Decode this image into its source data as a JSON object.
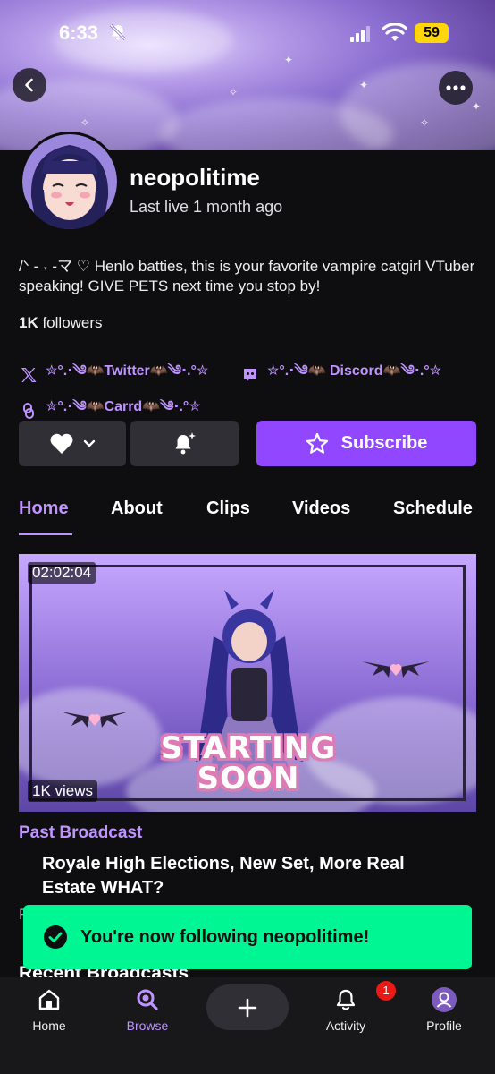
{
  "status_bar": {
    "time": "6:33",
    "battery": "59"
  },
  "channel": {
    "name": "neopolitime",
    "last_live": "Last live 1 month ago",
    "bio": "/ᐠ - ˕ -マ ♡ Henlo batties, this is your favorite vampire catgirl VTuber speaking! GIVE PETS next time you stop by!",
    "followers_count": "1K",
    "followers_label": " followers"
  },
  "socials": [
    {
      "icon": "x-icon",
      "label": "✮°.⋅༄🦇Twitter🦇༄⋅.°✮"
    },
    {
      "icon": "discord-icon",
      "label": "✮°.⋅༄🦇 Discord🦇༄⋅.°✮"
    },
    {
      "icon": "link-icon",
      "label": "✮°.⋅༄🦇Carrd🦇༄⋅.°✮"
    }
  ],
  "actions": {
    "subscribe_label": "Subscribe"
  },
  "tabs": [
    {
      "label": "Home",
      "active": true
    },
    {
      "label": "About"
    },
    {
      "label": "Clips"
    },
    {
      "label": "Videos"
    },
    {
      "label": "Schedule"
    }
  ],
  "video": {
    "duration": "02:02:04",
    "views": "1K views",
    "thumb_text_line1": "STARTING",
    "thumb_text_line2": "SOON",
    "category_label": "Past Broadcast",
    "title": "Royale High Elections, New Set, More Real Estate WHAT?",
    "subtitle_peek": "R"
  },
  "toast": {
    "message": "You're now following neopolitime!"
  },
  "section_peek": "Recent Broadcasts",
  "bottom_nav": {
    "home": "Home",
    "browse": "Browse",
    "activity": "Activity",
    "activity_badge": "1",
    "profile": "Profile"
  },
  "colors": {
    "accent": "#9147ff",
    "accent_light": "#bf94ff",
    "toast": "#00f593",
    "background": "#0e0e10"
  }
}
